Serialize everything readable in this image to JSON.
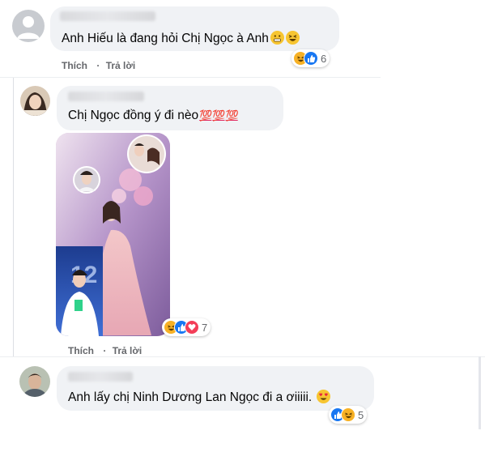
{
  "comments": [
    {
      "text": "Anh Hiếu là đang hỏi Chị Ngọc à Anh",
      "actions": {
        "like": "Thích",
        "reply": "Trả lời"
      },
      "reactions": {
        "icons": [
          "haha-icon",
          "like-icon"
        ],
        "count": "6"
      }
    },
    {
      "text": "Chị Ngọc đồng ý đi nèo",
      "hundreds": [
        "💯",
        "💯",
        "💯"
      ],
      "actions": {
        "like": "Thích",
        "reply": "Trả lời"
      },
      "reactions": {
        "icons": [
          "haha-icon",
          "like-icon",
          "love-icon"
        ],
        "count": "7"
      }
    },
    {
      "text": "Anh lấy chị Ninh Dương Lan Ngọc đi a ơiiiii.",
      "reactions": {
        "icons": [
          "like-icon",
          "haha-icon"
        ],
        "count": "5"
      }
    }
  ],
  "colors": {
    "bubble": "#f0f2f5",
    "like": "#1877f2",
    "haha": "#f7b125",
    "love": "#f33e58",
    "meta": "#65676b"
  }
}
